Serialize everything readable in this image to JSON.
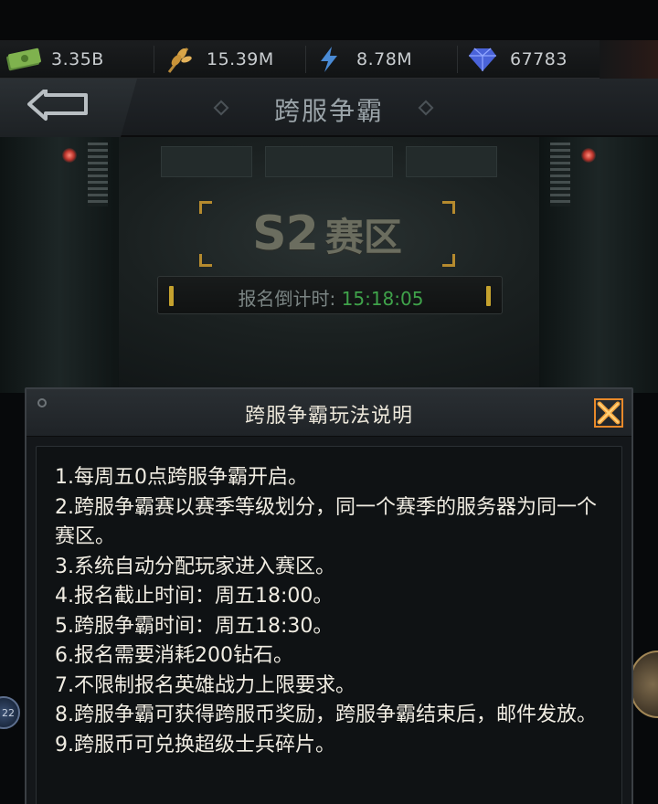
{
  "resources": [
    {
      "icon": "cash-icon",
      "value": "3.35B"
    },
    {
      "icon": "wheat-icon",
      "value": "15.39M"
    },
    {
      "icon": "energy-icon",
      "value": "8.78M"
    },
    {
      "icon": "diamond-icon",
      "value": "67783"
    }
  ],
  "header": {
    "title": "跨服争霸"
  },
  "zone": {
    "season": "S2",
    "zone_label": "赛区"
  },
  "countdown": {
    "label": "报名倒计时:",
    "value": "15:18:05"
  },
  "modal": {
    "title": "跨服争霸玩法说明",
    "rules": [
      "1.每周五0点跨服争霸开启。",
      "2.跨服争霸赛以赛季等级划分，同一个赛季的服务器为同一个赛区。",
      "3.系统自动分配玩家进入赛区。",
      "4.报名截止时间：周五18:00。",
      "5.跨服争霸时间：周五18:30。",
      "6.报名需要消耗200钻石。",
      "7.不限制报名英雄战力上限要求。",
      "8.跨服争霸可获得跨服币奖励，跨服争霸结束后，邮件发放。",
      "9.跨服币可兑换超级士兵碎片。"
    ]
  },
  "side": {
    "left_badge": "22"
  },
  "colors": {
    "countdown_value": "#3fa24a",
    "accent_gold": "#c5a22e",
    "close_orange": "#e8892a"
  }
}
